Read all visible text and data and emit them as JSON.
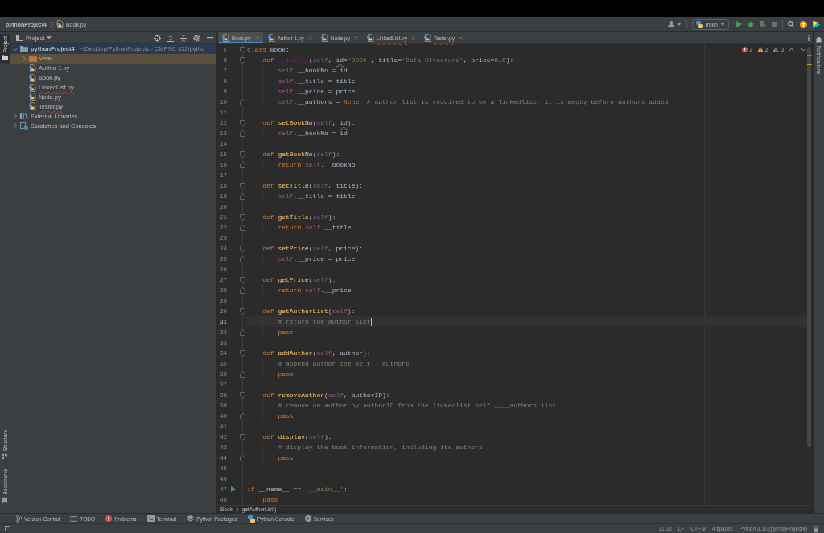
{
  "title_bar": {
    "project": "pythonProject4",
    "file": "Book.py",
    "run_config": "main"
  },
  "tool_strip_left": {
    "top": [
      {
        "kind": "project",
        "label": "Project",
        "selected": true
      }
    ],
    "bottom": [
      {
        "kind": "structure",
        "label": "Structure",
        "selected": false
      },
      {
        "kind": "bookmarks",
        "label": "Bookmarks",
        "selected": false
      }
    ]
  },
  "project_panel": {
    "title": "Project",
    "tree": [
      {
        "kind": "project",
        "label": "pythonProject4",
        "detail": "~/Desktop/PythonProjects - CMPSC 132/pytho",
        "expanded": true,
        "selected": true,
        "highlighted": false,
        "error": false,
        "children": [
          {
            "kind": "excluded",
            "label": "venv",
            "expanded": false,
            "selected": false,
            "highlighted": true,
            "error": false
          },
          {
            "kind": "python",
            "label": "Author 1.py",
            "selected": false,
            "highlighted": false,
            "error": false
          },
          {
            "kind": "python",
            "label": "Book.py",
            "selected": false,
            "highlighted": false,
            "error": false
          },
          {
            "kind": "python",
            "label": "LinkedList.py",
            "selected": false,
            "highlighted": false,
            "error": true
          },
          {
            "kind": "python",
            "label": "Node.py",
            "selected": false,
            "highlighted": false,
            "error": false
          },
          {
            "kind": "python",
            "label": "Tester.py",
            "selected": false,
            "highlighted": false,
            "error": true
          }
        ]
      },
      {
        "kind": "library",
        "label": "External Libraries",
        "expanded": false,
        "selected": false,
        "highlighted": false,
        "error": false
      },
      {
        "kind": "scratches",
        "label": "Scratches and Consoles",
        "expanded": false,
        "selected": false,
        "highlighted": false,
        "error": false
      }
    ]
  },
  "tabs": [
    {
      "label": "Book.py",
      "selected": true,
      "error": false
    },
    {
      "label": "Author 1.py",
      "selected": false,
      "error": false
    },
    {
      "label": "Node.py",
      "selected": false,
      "error": false
    },
    {
      "label": "LinkedList.py",
      "selected": false,
      "error": true
    },
    {
      "label": "Tester.py",
      "selected": false,
      "error": true
    }
  ],
  "editor": {
    "inspections": [
      {
        "kind": "error",
        "count": "2"
      },
      {
        "kind": "warning",
        "count": "2"
      },
      {
        "kind": "weak",
        "count": "3"
      }
    ],
    "lines": [
      {
        "number": "5",
        "kind": "opener",
        "current": false,
        "tokens": [
          {
            "kind": "keyword",
            "text": "class"
          },
          {
            "kind": "plain",
            "text": " Book:"
          }
        ]
      },
      {
        "number": "6",
        "kind": "opener",
        "current": false,
        "tokens": [
          {
            "kind": "keyword",
            "text": "    def"
          },
          {
            "kind": "magic",
            "text": " __init__"
          },
          {
            "kind": "plain",
            "text": "("
          },
          {
            "kind": "self",
            "text": "self"
          },
          {
            "kind": "plain",
            "text": ", "
          },
          {
            "kind": "shadowed",
            "text": "id"
          },
          {
            "kind": "plain",
            "text": "="
          },
          {
            "kind": "string",
            "text": "'B000'"
          },
          {
            "kind": "plain",
            "text": ", title="
          },
          {
            "kind": "string",
            "text": "'Data Structure'"
          },
          {
            "kind": "plain",
            "text": ", price="
          },
          {
            "kind": "number",
            "text": "0.0"
          },
          {
            "kind": "plain",
            "text": "):"
          }
        ]
      },
      {
        "number": "7",
        "kind": "plain",
        "current": false,
        "tokens": [
          {
            "kind": "self",
            "text": "        self"
          },
          {
            "kind": "plain",
            "text": ".__bookNo = id"
          }
        ]
      },
      {
        "number": "8",
        "kind": "plain",
        "current": false,
        "tokens": [
          {
            "kind": "self",
            "text": "        self"
          },
          {
            "kind": "plain",
            "text": ".__title = title"
          }
        ]
      },
      {
        "number": "9",
        "kind": "plain",
        "current": false,
        "tokens": [
          {
            "kind": "self",
            "text": "        self"
          },
          {
            "kind": "plain",
            "text": ".__price = price"
          }
        ]
      },
      {
        "number": "10",
        "kind": "closer",
        "current": false,
        "tokens": [
          {
            "kind": "self",
            "text": "        self"
          },
          {
            "kind": "plain",
            "text": ".__authors = "
          },
          {
            "kind": "keyword",
            "text": "None"
          },
          {
            "kind": "comment",
            "text": "  # author list is required to be a linkedlist, it is empty before authors added"
          }
        ]
      },
      {
        "number": "11",
        "kind": "plain",
        "current": false
      },
      {
        "number": "12",
        "kind": "opener",
        "current": false,
        "tokens": [
          {
            "kind": "keyword",
            "text": "    def"
          },
          {
            "kind": "function",
            "text": " setBookNo"
          },
          {
            "kind": "plain",
            "text": "("
          },
          {
            "kind": "self",
            "text": "self"
          },
          {
            "kind": "plain",
            "text": ", "
          },
          {
            "kind": "shadowed",
            "text": "id"
          },
          {
            "kind": "plain",
            "text": "):"
          }
        ]
      },
      {
        "number": "13",
        "kind": "closer",
        "current": false,
        "tokens": [
          {
            "kind": "self",
            "text": "        self"
          },
          {
            "kind": "plain",
            "text": ".__bookNo = id"
          }
        ]
      },
      {
        "number": "14",
        "kind": "plain",
        "current": false
      },
      {
        "number": "15",
        "kind": "opener",
        "current": false,
        "tokens": [
          {
            "kind": "keyword",
            "text": "    def"
          },
          {
            "kind": "function",
            "text": " getBookNo"
          },
          {
            "kind": "plain",
            "text": "("
          },
          {
            "kind": "self",
            "text": "self"
          },
          {
            "kind": "plain",
            "text": "):"
          }
        ]
      },
      {
        "number": "16",
        "kind": "closer",
        "current": false,
        "tokens": [
          {
            "kind": "keyword",
            "text": "        return"
          },
          {
            "kind": "self",
            "text": " self"
          },
          {
            "kind": "plain",
            "text": ".__bookNo"
          }
        ]
      },
      {
        "number": "17",
        "kind": "plain",
        "current": false
      },
      {
        "number": "18",
        "kind": "opener",
        "current": false,
        "tokens": [
          {
            "kind": "keyword",
            "text": "    def"
          },
          {
            "kind": "function",
            "text": " setTitle"
          },
          {
            "kind": "plain",
            "text": "("
          },
          {
            "kind": "self",
            "text": "self"
          },
          {
            "kind": "plain",
            "text": ", title):"
          }
        ]
      },
      {
        "number": "19",
        "kind": "closer",
        "current": false,
        "tokens": [
          {
            "kind": "self",
            "text": "        self"
          },
          {
            "kind": "plain",
            "text": ".__title = title"
          }
        ]
      },
      {
        "number": "20",
        "kind": "plain",
        "current": false
      },
      {
        "number": "21",
        "kind": "opener",
        "current": false,
        "tokens": [
          {
            "kind": "keyword",
            "text": "    def"
          },
          {
            "kind": "function",
            "text": " getTitle"
          },
          {
            "kind": "plain",
            "text": "("
          },
          {
            "kind": "self",
            "text": "self"
          },
          {
            "kind": "plain",
            "text": "):"
          }
        ]
      },
      {
        "number": "22",
        "kind": "closer",
        "current": false,
        "tokens": [
          {
            "kind": "keyword",
            "text": "        return"
          },
          {
            "kind": "self",
            "text": " self"
          },
          {
            "kind": "plain",
            "text": ".__title"
          }
        ]
      },
      {
        "number": "23",
        "kind": "plain",
        "current": false
      },
      {
        "number": "24",
        "kind": "opener",
        "current": false,
        "tokens": [
          {
            "kind": "keyword",
            "text": "    def"
          },
          {
            "kind": "function",
            "text": " setPrice"
          },
          {
            "kind": "plain",
            "text": "("
          },
          {
            "kind": "self",
            "text": "self"
          },
          {
            "kind": "plain",
            "text": ", price):"
          }
        ]
      },
      {
        "number": "25",
        "kind": "closer",
        "current": false,
        "tokens": [
          {
            "kind": "self",
            "text": "        self"
          },
          {
            "kind": "plain",
            "text": ".__price = price"
          }
        ]
      },
      {
        "number": "26",
        "kind": "plain",
        "current": false
      },
      {
        "number": "27",
        "kind": "opener",
        "current": false,
        "tokens": [
          {
            "kind": "keyword",
            "text": "    def"
          },
          {
            "kind": "function",
            "text": " getPrice"
          },
          {
            "kind": "plain",
            "text": "("
          },
          {
            "kind": "self",
            "text": "self"
          },
          {
            "kind": "plain",
            "text": "):"
          }
        ]
      },
      {
        "number": "28",
        "kind": "closer",
        "current": false,
        "tokens": [
          {
            "kind": "keyword",
            "text": "        return"
          },
          {
            "kind": "self",
            "text": " self"
          },
          {
            "kind": "plain",
            "text": ".__price"
          }
        ]
      },
      {
        "number": "29",
        "kind": "plain",
        "current": false
      },
      {
        "number": "30",
        "kind": "opener",
        "current": false,
        "tokens": [
          {
            "kind": "keyword",
            "text": "    def"
          },
          {
            "kind": "function",
            "text": " getAuthorList"
          },
          {
            "kind": "plain",
            "text": "("
          },
          {
            "kind": "self",
            "text": "self"
          },
          {
            "kind": "plain",
            "text": "):"
          }
        ]
      },
      {
        "number": "31",
        "kind": "plain",
        "current": true,
        "tokens": [
          {
            "kind": "comment",
            "text": "        # return the author list"
          }
        ]
      },
      {
        "number": "32",
        "kind": "closer",
        "current": false,
        "tokens": [
          {
            "kind": "keyword",
            "text": "        pass"
          }
        ]
      },
      {
        "number": "33",
        "kind": "plain",
        "current": false
      },
      {
        "number": "34",
        "kind": "opener",
        "current": false,
        "tokens": [
          {
            "kind": "keyword",
            "text": "    def"
          },
          {
            "kind": "function",
            "text": " addAuthor"
          },
          {
            "kind": "plain",
            "text": "("
          },
          {
            "kind": "self",
            "text": "self"
          },
          {
            "kind": "plain",
            "text": ", author):"
          }
        ]
      },
      {
        "number": "35",
        "kind": "plain",
        "current": false,
        "tokens": [
          {
            "kind": "comment",
            "text": "        # append author the self.__authors"
          }
        ]
      },
      {
        "number": "36",
        "kind": "closer",
        "current": false,
        "tokens": [
          {
            "kind": "keyword",
            "text": "        pass"
          }
        ]
      },
      {
        "number": "37",
        "kind": "plain",
        "current": false
      },
      {
        "number": "38",
        "kind": "opener",
        "current": false,
        "tokens": [
          {
            "kind": "keyword",
            "text": "    def"
          },
          {
            "kind": "function",
            "text": " removeAuthor"
          },
          {
            "kind": "plain",
            "text": "("
          },
          {
            "kind": "self",
            "text": "self"
          },
          {
            "kind": "plain",
            "text": ", authorID):"
          }
        ]
      },
      {
        "number": "39",
        "kind": "plain",
        "current": false,
        "tokens": [
          {
            "kind": "comment",
            "text": "        # remove an author by authorID from the linkedlist self.____authors list"
          }
        ]
      },
      {
        "number": "40",
        "kind": "closer",
        "current": false,
        "tokens": [
          {
            "kind": "keyword",
            "text": "        pass"
          }
        ]
      },
      {
        "number": "41",
        "kind": "plain",
        "current": false
      },
      {
        "number": "42",
        "kind": "opener",
        "current": false,
        "tokens": [
          {
            "kind": "keyword",
            "text": "    def"
          },
          {
            "kind": "function",
            "text": " display"
          },
          {
            "kind": "plain",
            "text": "("
          },
          {
            "kind": "self",
            "text": "self"
          },
          {
            "kind": "plain",
            "text": "):"
          }
        ]
      },
      {
        "number": "43",
        "kind": "plain",
        "current": false,
        "tokens": [
          {
            "kind": "comment",
            "text": "        # display the book information, including its authors"
          }
        ]
      },
      {
        "number": "44",
        "kind": "closer",
        "current": false,
        "tokens": [
          {
            "kind": "keyword",
            "text": "        pass"
          }
        ]
      },
      {
        "number": "45",
        "kind": "plain",
        "current": false
      },
      {
        "number": "46",
        "kind": "plain",
        "current": false
      },
      {
        "number": "47",
        "kind": "runnable",
        "current": false,
        "tokens": [
          {
            "kind": "keyword",
            "text": "if"
          },
          {
            "kind": "plain",
            "text": " __name__ == "
          },
          {
            "kind": "string",
            "text": "'__main__'"
          },
          {
            "kind": "plain",
            "text": ":"
          }
        ]
      },
      {
        "number": "48",
        "kind": "plain",
        "current": false,
        "tokens": [
          {
            "kind": "keyword",
            "text": "    pass"
          }
        ]
      }
    ]
  },
  "breadcrumbs": [
    "Book",
    "getAuthorList()"
  ],
  "tool_strip_right": {
    "label": "Notifications"
  },
  "tool_windows": [
    {
      "kind": "vcs",
      "label": "Version Control"
    },
    {
      "kind": "todo",
      "label": "TODO"
    },
    {
      "kind": "problems",
      "label": "Problems"
    },
    {
      "kind": "terminal",
      "label": "Terminal"
    },
    {
      "kind": "packages",
      "label": "Python Packages"
    },
    {
      "kind": "console",
      "label": "Python Console"
    },
    {
      "kind": "services",
      "label": "Services"
    }
  ],
  "status_bar": [
    "31:33",
    "LF",
    "UTF-8",
    "4 spaces",
    "Python 3.10 (pythonProject4)"
  ]
}
